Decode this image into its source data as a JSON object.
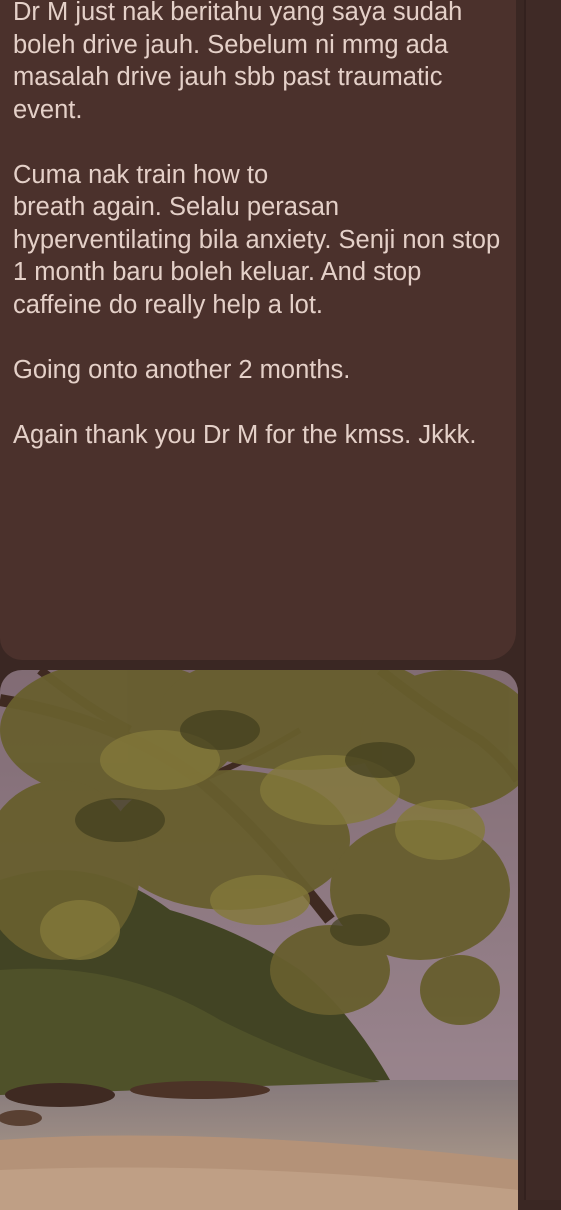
{
  "message": {
    "text": "Dr M just nak beritahu yang saya sudah boleh drive jauh. Sebelum ni mmg ada masalah drive jauh sbb past traumatic event.\n\n Cuma nak train how to\nbreath again. Selalu perasan hyperventilating bila anxiety. Senji non stop 1 month baru boleh keluar. And stop caffeine do really help a lot.\n\nGoing onto another 2 months.\n\nAgain thank you Dr M for the kmss. Jkkk."
  },
  "colors": {
    "background": "#3a2723",
    "bubble": "#4b312c",
    "text": "#e4d0c8"
  }
}
